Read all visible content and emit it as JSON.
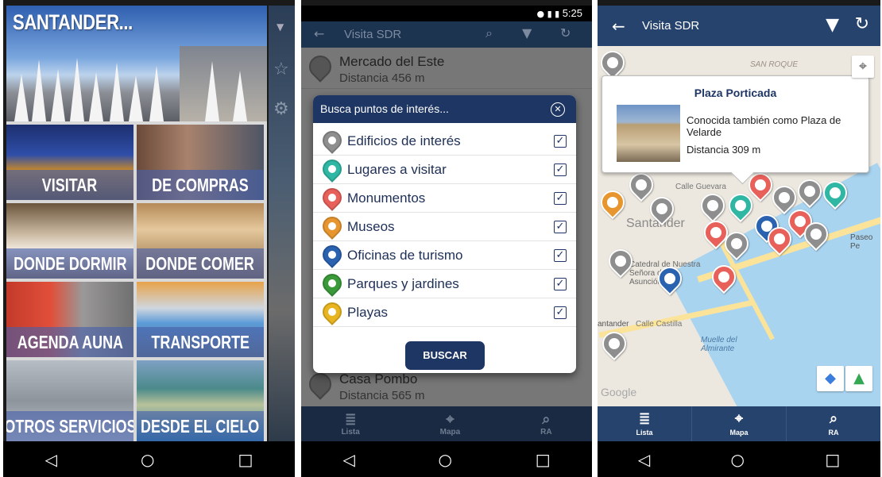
{
  "phone1": {
    "hero_title": "SANTANDER...",
    "tiles": [
      {
        "label": "VISITAR"
      },
      {
        "label": "DE COMPRAS"
      },
      {
        "label": "DONDE DORMIR"
      },
      {
        "label": "DONDE COMER"
      },
      {
        "label": "AGENDA AUNA"
      },
      {
        "label": "TRANSPORTE"
      },
      {
        "label": "OTROS SERVICIOS"
      },
      {
        "label": "DESDE EL CIELO"
      }
    ]
  },
  "phone2": {
    "status_time": "5:25",
    "bar_title": "Visita SDR",
    "list": [
      {
        "name": "Mercado del Este",
        "dist": "Distancia 456 m"
      },
      {
        "name": "Casa Pombo",
        "dist": "Distancia 565 m"
      }
    ],
    "modal": {
      "title": "Busca puntos de interés...",
      "filters": [
        {
          "label": "Edificios de interés",
          "color": "#8e8e8e"
        },
        {
          "label": "Lugares a visitar",
          "color": "#2fb7a3"
        },
        {
          "label": "Monumentos",
          "color": "#e8605a"
        },
        {
          "label": "Museos",
          "color": "#e7962f"
        },
        {
          "label": "Oficinas de turismo",
          "color": "#2a62b0"
        },
        {
          "label": "Parques y jardines",
          "color": "#3a9a3a"
        },
        {
          "label": "Playas",
          "color": "#e8b420"
        }
      ],
      "button": "BUSCAR"
    },
    "tabs": [
      "Lista",
      "Mapa",
      "RA"
    ]
  },
  "phone3": {
    "bar_title": "Visita SDR",
    "callout": {
      "title": "Plaza Porticada",
      "desc": "Conocida también como Plaza de Velarde",
      "dist": "Distancia 309 m"
    },
    "map_labels": [
      "SAN ROQUE",
      "Calle Guevara",
      "Santander",
      "Paseo Pe",
      "Catedral de Nuestra Señora de la Asunción...",
      "Calle Castilla",
      "Muelle del Almirante",
      "Google",
      "antander"
    ],
    "tabs": [
      "Lista",
      "Mapa",
      "RA"
    ]
  }
}
